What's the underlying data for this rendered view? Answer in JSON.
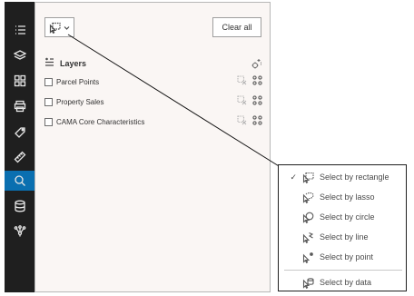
{
  "toolbar": {
    "selection_tool_icon": "select-by-rectangle-icon",
    "clear_all_label": "Clear all"
  },
  "layers": {
    "title": "Layers",
    "items": [
      {
        "name": "Parcel Points"
      },
      {
        "name": "Property Sales"
      },
      {
        "name": "CAMA Core Characteristics"
      }
    ]
  },
  "menu": {
    "items": [
      {
        "label": "Select by rectangle",
        "icon": "select-rectangle-icon",
        "checked": true
      },
      {
        "label": "Select by lasso",
        "icon": "select-lasso-icon",
        "checked": false
      },
      {
        "label": "Select by circle",
        "icon": "select-circle-icon",
        "checked": false
      },
      {
        "label": "Select by line",
        "icon": "select-line-icon",
        "checked": false
      },
      {
        "label": "Select by point",
        "icon": "select-point-icon",
        "checked": false
      },
      {
        "label": "Select by data",
        "icon": "select-data-icon",
        "checked": false
      }
    ],
    "check_mark": "✓"
  },
  "colors": {
    "rail_bg": "#1f1f1f",
    "rail_active": "#0a6fb0",
    "panel_bg": "#faf6f4"
  }
}
